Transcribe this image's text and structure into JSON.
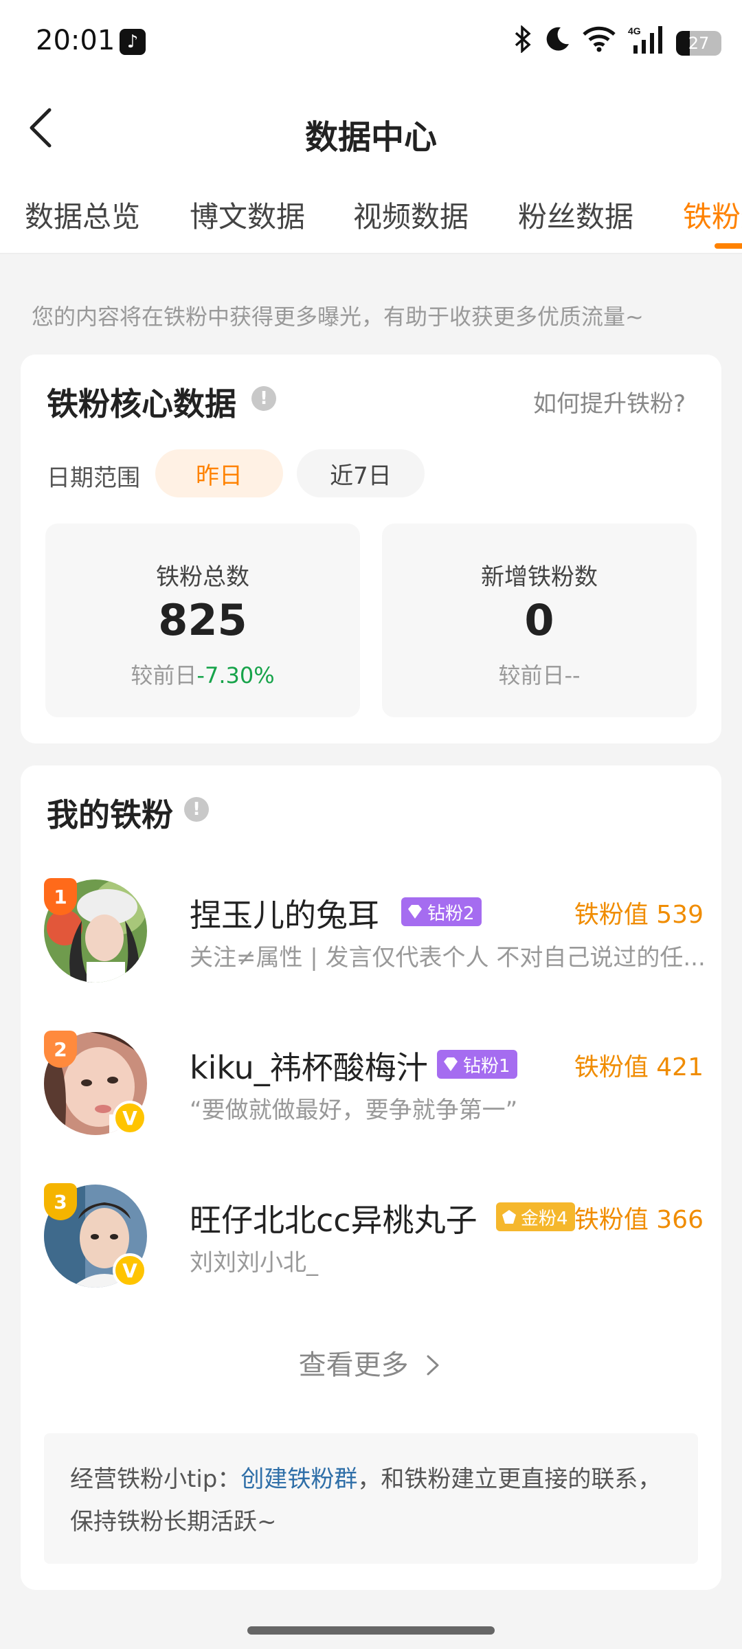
{
  "status_bar": {
    "time": "20:01",
    "battery": "27",
    "network": "4G",
    "icons": [
      "tiktok-icon",
      "bluetooth-icon",
      "moon-icon",
      "wifi-icon",
      "signal-icon",
      "battery-icon"
    ]
  },
  "header": {
    "title": "数据中心",
    "back_icon": "back-arrow-icon"
  },
  "tabs": [
    {
      "label": "数据总览",
      "active": false
    },
    {
      "label": "博文数据",
      "active": false
    },
    {
      "label": "视频数据",
      "active": false
    },
    {
      "label": "粉丝数据",
      "active": false
    },
    {
      "label": "铁粉数据",
      "active": true
    }
  ],
  "info_text": "您的内容将在铁粉中获得更多曝光，有助于收获更多优质流量~",
  "core": {
    "title": "铁粉核心数据",
    "info_icon": "!",
    "how_link": "如何提升铁粉?",
    "date_label": "日期范围",
    "date_options": [
      "昨日",
      "近7日"
    ],
    "date_selected": "昨日",
    "total": {
      "label": "铁粉总数",
      "value": "825",
      "compare_prefix": "较前日",
      "compare_value": "-7.30%"
    },
    "new": {
      "label": "新增铁粉数",
      "value": "0",
      "compare_prefix": "较前日",
      "compare_value": "--"
    }
  },
  "fans": {
    "title": "我的铁粉",
    "info_icon": "!",
    "list": [
      {
        "rank": "1",
        "name": "捏玉儿的兔耳",
        "badge": "钻粉2",
        "badge_type": "diamond",
        "value": "铁粉值 539",
        "bio": "关注≠属性 | 发言仅代表个人 不对自己说过的任...",
        "verified": false
      },
      {
        "rank": "2",
        "name": "kiku_祎杯酸梅汁",
        "badge": "钻粉1",
        "badge_type": "diamond",
        "value": "铁粉值 421",
        "bio": "“要做就做最好，要争就争第一”",
        "verified": true
      },
      {
        "rank": "3",
        "name": "旺仔北北cc异桃丸子",
        "badge": "金粉4",
        "badge_type": "gold",
        "value": "铁粉值 366",
        "bio": "刘刘刘小北_",
        "verified": true
      }
    ],
    "verified_mark": "V",
    "view_more": "查看更多",
    "tip_prefix": "经营铁粉小tip：",
    "tip_link": "创建铁粉群",
    "tip_suffix": "，和铁粉建立更直接的联系，保持铁粉长期活跃~"
  },
  "colors": {
    "accent": "#ff8200",
    "green": "#17a34a",
    "link": "#2f6fa8"
  }
}
